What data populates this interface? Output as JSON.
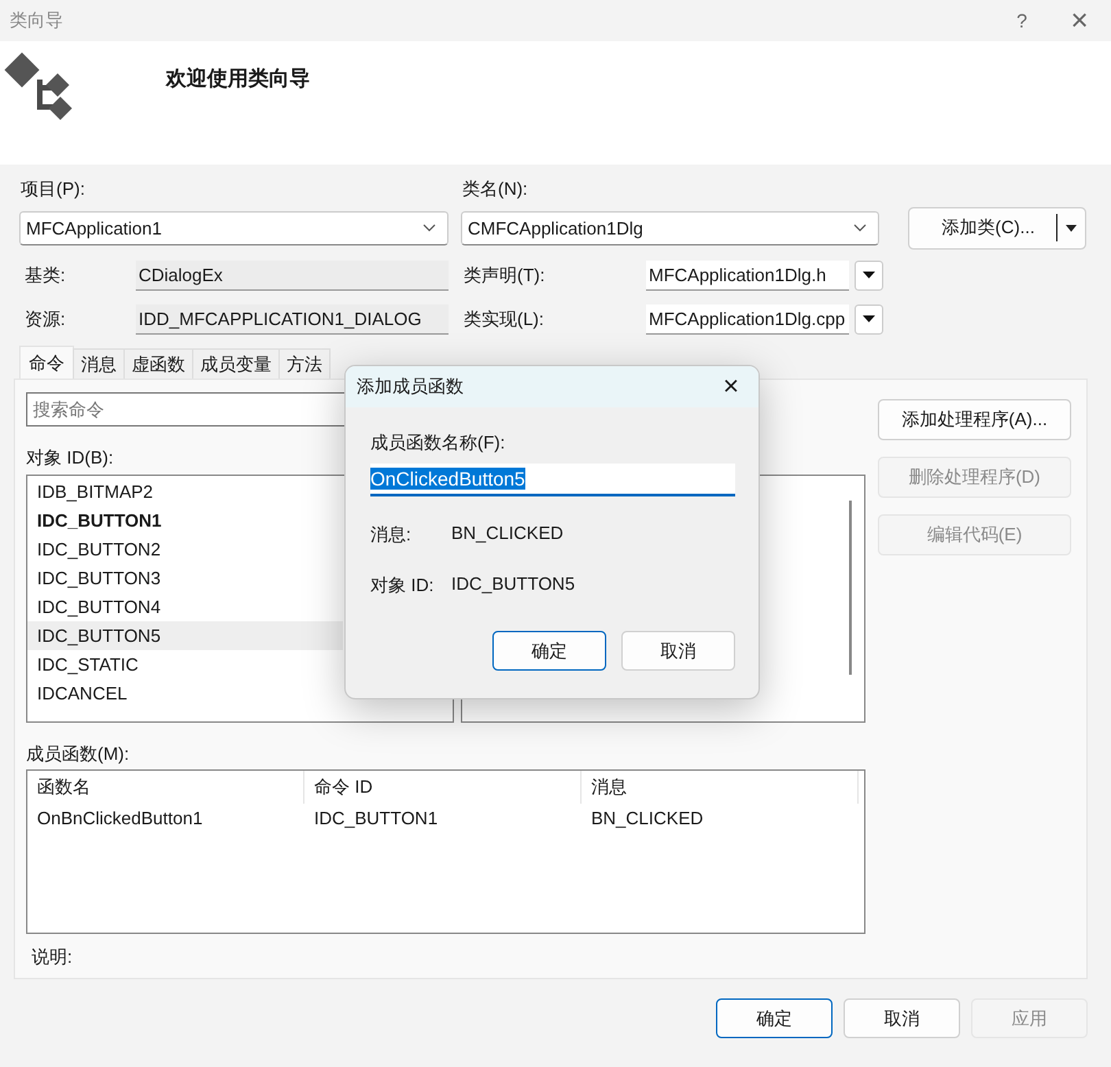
{
  "window": {
    "title": "类向导",
    "help": "?",
    "close": "×"
  },
  "header": {
    "title": "欢迎使用类向导"
  },
  "project": {
    "label": "项目(P):",
    "value": "MFCApplication1"
  },
  "class_name": {
    "label": "类名(N):",
    "value": "CMFCApplication1Dlg"
  },
  "add_class_button": "添加类(C)...",
  "base_class": {
    "label": "基类:",
    "value": "CDialogEx"
  },
  "class_declaration": {
    "label": "类声明(T):",
    "value": "MFCApplication1Dlg.h"
  },
  "resource": {
    "label": "资源:",
    "value": "IDD_MFCAPPLICATION1_DIALOG"
  },
  "class_implementation": {
    "label": "类实现(L):",
    "value": "MFCApplication1Dlg.cpp"
  },
  "tabs": [
    {
      "label": "命令",
      "selected": true
    },
    {
      "label": "消息",
      "selected": false
    },
    {
      "label": "虚函数",
      "selected": false
    },
    {
      "label": "成员变量",
      "selected": false
    },
    {
      "label": "方法",
      "selected": false
    }
  ],
  "search": {
    "placeholder": "搜索命令"
  },
  "object_ids": {
    "label": "对象 ID(B):",
    "items": [
      {
        "text": "IDB_BITMAP2",
        "bold": false,
        "selected": false
      },
      {
        "text": "IDC_BUTTON1",
        "bold": true,
        "selected": false
      },
      {
        "text": "IDC_BUTTON2",
        "bold": false,
        "selected": false
      },
      {
        "text": "IDC_BUTTON3",
        "bold": false,
        "selected": false
      },
      {
        "text": "IDC_BUTTON4",
        "bold": false,
        "selected": false
      },
      {
        "text": "IDC_BUTTON5",
        "bold": false,
        "selected": true
      },
      {
        "text": "IDC_STATIC",
        "bold": false,
        "selected": false
      },
      {
        "text": "IDCANCEL",
        "bold": false,
        "selected": false
      }
    ]
  },
  "handler_buttons": [
    {
      "label": "添加处理程序(A)...",
      "disabled": false
    },
    {
      "label": "删除处理程序(D)",
      "disabled": true
    },
    {
      "label": "编辑代码(E)",
      "disabled": true
    }
  ],
  "member_functions": {
    "label": "成员函数(M):",
    "columns": [
      "函数名",
      "命令 ID",
      "消息"
    ],
    "rows": [
      [
        "OnBnClickedButton1",
        "IDC_BUTTON1",
        "BN_CLICKED"
      ]
    ]
  },
  "description": {
    "label": "说明:"
  },
  "footer_buttons": [
    {
      "label": "确定",
      "default": true,
      "disabled": false
    },
    {
      "label": "取消",
      "default": false,
      "disabled": false
    },
    {
      "label": "应用",
      "default": false,
      "disabled": true
    }
  ],
  "dialog": {
    "title": "添加成员函数",
    "close": "×",
    "name_label": "成员函数名称(F):",
    "name_value": "OnClickedButton5",
    "message_label": "消息:",
    "message_value": "BN_CLICKED",
    "object_label": "对象 ID:",
    "object_value": "IDC_BUTTON5",
    "buttons": [
      {
        "label": "确定",
        "default": true
      },
      {
        "label": "取消",
        "default": false
      }
    ]
  }
}
